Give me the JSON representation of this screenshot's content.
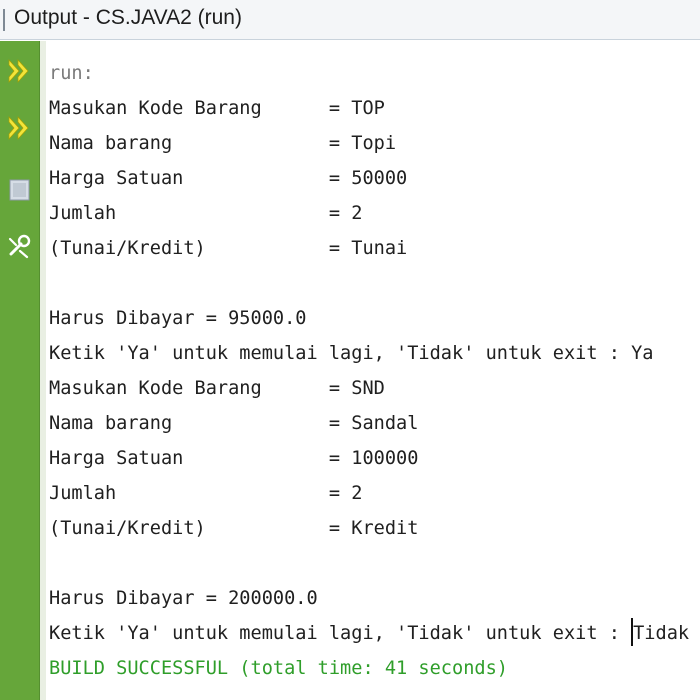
{
  "window": {
    "title": "Output - CS.JAVA2 (run)"
  },
  "toolbar": {
    "buttons": [
      {
        "name": "rerun-button",
        "icon": "double-chevron-right-icon"
      },
      {
        "name": "rerun-with-options-button",
        "icon": "double-chevron-right-icon"
      },
      {
        "name": "stop-button",
        "icon": "stop-square-icon"
      },
      {
        "name": "settings-button",
        "icon": "wrench-icon"
      }
    ],
    "colors": {
      "background": "#66a63a",
      "icon_yellow": "#f2e43a"
    }
  },
  "console": {
    "run": "run:",
    "lines": [
      "Masukan Kode Barang      = TOP",
      "Nama barang              = Topi",
      "Harga Satuan             = 50000",
      "Jumlah                   = 2",
      "(Tunai/Kredit)           = Tunai",
      "",
      "Harus Dibayar = 95000.0",
      "Ketik 'Ya' untuk memulai lagi, 'Tidak' untuk exit : Ya",
      "Masukan Kode Barang      = SND",
      "Nama barang              = Sandal",
      "Harga Satuan             = 100000",
      "Jumlah                   = 2",
      "(Tunai/Kredit)           = Kredit",
      "",
      "Harus Dibayar = 200000.0"
    ],
    "prompt": "Ketik 'Ya' untuk memulai lagi, 'Tidak' untuk exit : ",
    "input": "Tidak",
    "build": "BUILD SUCCESSFUL (total time: 41 seconds)",
    "colors": {
      "text": "#202020",
      "run": "#7a7a7a",
      "build": "#2f9e2a"
    }
  }
}
